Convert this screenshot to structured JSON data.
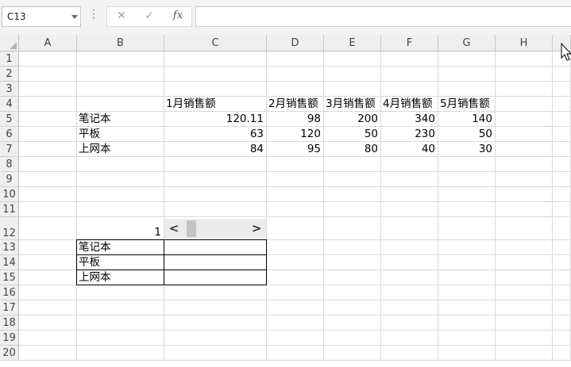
{
  "formula_bar": {
    "name_box": "C13",
    "cancel_icon": "✕",
    "confirm_icon": "✓",
    "fx_label": "fx",
    "formula": ""
  },
  "columns": [
    "A",
    "B",
    "C",
    "D",
    "E",
    "F",
    "G",
    "H"
  ],
  "rows": [
    "1",
    "2",
    "3",
    "4",
    "5",
    "6",
    "7",
    "8",
    "9",
    "10",
    "11",
    "12",
    "13",
    "14",
    "15",
    "16",
    "17",
    "18",
    "19",
    "20"
  ],
  "cells": {
    "C4": "1月销售额",
    "D4": "2月销售额",
    "E4": "3月销售额",
    "F4": "4月销售额",
    "G4": "5月销售额",
    "B5": "笔记本",
    "C5": "120.11",
    "D5": "98",
    "E5": "200",
    "F5": "340",
    "G5": "140",
    "B6": "平板",
    "C6": "63",
    "D6": "120",
    "E6": "50",
    "F6": "230",
    "G6": "50",
    "B7": "上网本",
    "C7": "84",
    "D7": "95",
    "E7": "80",
    "F7": "40",
    "G7": "30",
    "B12": "1",
    "B13": "笔记本",
    "B14": "平板",
    "B15": "上网本"
  },
  "scrollbar_control": {
    "left_arrow": "<",
    "right_arrow": ">",
    "value": 1
  }
}
